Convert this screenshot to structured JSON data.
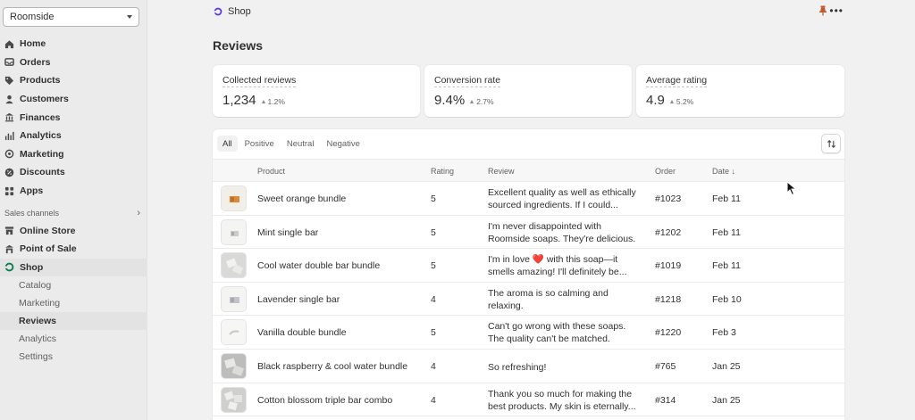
{
  "sidebar": {
    "store": "Roomside",
    "items": [
      {
        "label": "Home",
        "icon": "home-icon"
      },
      {
        "label": "Orders",
        "icon": "orders-icon"
      },
      {
        "label": "Products",
        "icon": "tag-icon"
      },
      {
        "label": "Customers",
        "icon": "person-icon"
      },
      {
        "label": "Finances",
        "icon": "bank-icon"
      },
      {
        "label": "Analytics",
        "icon": "bar-chart-icon"
      },
      {
        "label": "Marketing",
        "icon": "target-icon"
      },
      {
        "label": "Discounts",
        "icon": "discount-icon"
      },
      {
        "label": "Apps",
        "icon": "apps-icon"
      }
    ],
    "sales_channels_label": "Sales channels",
    "channels": [
      {
        "label": "Online Store",
        "icon": "store-icon"
      },
      {
        "label": "Point of Sale",
        "icon": "pos-icon"
      },
      {
        "label": "Shop",
        "icon": "shop-icon"
      }
    ],
    "shop_subitems": [
      "Catalog",
      "Marketing",
      "Reviews",
      "Analytics",
      "Settings"
    ]
  },
  "topbar": {
    "title": "Shop"
  },
  "page": {
    "title": "Reviews"
  },
  "metrics": [
    {
      "label": "Collected reviews",
      "value": "1,234",
      "delta": "1.2%"
    },
    {
      "label": "Conversion rate",
      "value": "9.4%",
      "delta": "2.7%"
    },
    {
      "label": "Average rating",
      "value": "4.9",
      "delta": "5.2%"
    }
  ],
  "tabs": [
    "All",
    "Positive",
    "Neutral",
    "Negative"
  ],
  "table": {
    "headers": {
      "product": "Product",
      "rating": "Rating",
      "review": "Review",
      "order": "Order",
      "date": "Date ↓"
    },
    "rows": [
      {
        "product": "Sweet orange bundle",
        "rating": "5",
        "review1": "Excellent quality as well as ethically",
        "review2": "sourced ingredients. If I could...",
        "order": "#1023",
        "date": "Feb 11"
      },
      {
        "product": "Mint single bar",
        "rating": "5",
        "review1": "I'm never disappointed with",
        "review2": "Roomside soaps. They're delicious.",
        "order": "#1202",
        "date": "Feb 11"
      },
      {
        "product": "Cool water double bar bundle",
        "rating": "5",
        "review1": "I'm in love ❤️ with this soap—it",
        "review2": "smells amazing! I'll definitely be...",
        "order": "#1019",
        "date": "Feb 11"
      },
      {
        "product": "Lavender single bar",
        "rating": "4",
        "review1": "The aroma is so calming and",
        "review2": "relaxing.",
        "order": "#1218",
        "date": "Feb 10"
      },
      {
        "product": "Vanilla double bundle",
        "rating": "5",
        "review1": "Can't go wrong with these soaps.",
        "review2": "The quality can't be matched.",
        "order": "#1220",
        "date": "Feb 3"
      },
      {
        "product": "Black raspberry & cool water bundle",
        "rating": "4",
        "review1": "So refreshing!",
        "review2": "",
        "order": "#765",
        "date": "Jan 25"
      },
      {
        "product": "Cotton blossom triple bar combo",
        "rating": "4",
        "review1": "Thank you so much for making the",
        "review2": "best products. My skin is eternally...",
        "order": "#314",
        "date": "Jan 25"
      }
    ]
  }
}
